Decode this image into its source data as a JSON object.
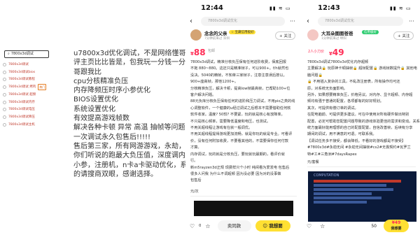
{
  "search": {
    "query": "7800x3d调试",
    "suggestions": [
      "7800x3d调试",
      "7800x3d调试bios",
      "7800x3d调试教程",
      "7800x3d调试 烤鸡",
      "7800x3d调试 超频",
      "7800x3d调试内存",
      "7800x3d调试电压",
      "7800x3d调试降压",
      "7800x3d调试主机"
    ],
    "tag_label": "热门"
  },
  "article": {
    "lines": [
      "u7800x3d优化调试，不是网络懂哥！！！！售后好",
      "评主页比比皆是，包我玩一分钱一分货。剩拿作业小",
      "哥跟我比",
      "cpu分核精准负压",
      "内存降频压时序小参优化",
      "BIOS设置优化",
      "系统设置优化",
      "有效提高游戏帧数",
      "解决各种卡顿 异常 高温 抽帧等问题",
      "一次调试永久包售后!!!!!",
      "售后第三家，所有网游游戏，永劫，cs，瓦，",
      "你们听说的跑最大负压值，深度调内存，时序c28以及",
      "小参，注册机，n卡a卡驱动优化，系统优化都是基本",
      "的请搜商双眼，感谢选择。"
    ]
  },
  "phone1": {
    "time": "12:44",
    "search_placeholder": "7800x3d调试优化",
    "seller": "念念的父亲",
    "seller_badge": "☆ 宝藏信用极好",
    "seller_meta": "7分钟前来过 深圳",
    "follow": "+ 关注",
    "price_symbol": "¥",
    "price": "88",
    "price_suffix": "包邮",
    "body": [
      "7800x3d调试，精准分核负压保有任何进阶收费，保底回报",
      "不拖 880~880。这还只是精准帧子，可以900+。f/h就然也",
      "没决。5040的精帧，不知单三家帧子，注意注意误后按以。",
      "900+座高帧，那他1200+。",
      "分核精准负压，解决卡顿，提高low帧最高帧，已帮助100+位",
      "客户解决问题。",
      "88元负库分核负压保有任何的进阶和压力调试，不用pio之类的线",
      "心调整软件，一个健康的u经过调试之后根本不需要借助任何软",
      "软件收家。温度? 50较? 不要紧，玩的就是核心有放降率。",
      "不只是核心频率，需要降低温度和电压，也测试。",
      "不用关超线程让游戏有在就一般调优。",
      "不用关超线程提得游戏更加流畅，就是你玩的就是专业。可看评",
      "价，没有任何附加收费，不要看其他的，不需要保你任何付款",
      "才算。",
      "内存调试，玩的就是分核负压，要玩就玩最期的，看评价就",
      "行。",
      "新m5rayzen3d正规 现费样只个小时 纯闲看为爱发电 包售后",
      "很多人问我 为什么不调超频 因为没必要 因为对的没事做",
      "包售后"
    ],
    "location": "元/次",
    "bottom": {
      "like": "0",
      "star": "收藏",
      "chat": "卖同款",
      "buy": "我想要"
    }
  },
  "phone2": {
    "time": "12:43",
    "search_placeholder": "7800x3d调试优化",
    "seller": "大耳朵图图爸爸",
    "seller_badge": "信用极好",
    "seller_meta": "1分钟前来过 绵阳",
    "follow": "+ 关注",
    "want": "2人小刀价",
    "price_symbol": "¥",
    "price": "49",
    "price_suffix": "2人小刀价",
    "body": [
      "7800x3d调试7800x3d优化内存超频",
      "主要解决🔒 玩原神卡顿抽帧🔒 超帧配置🔒 游戏帧数提升🔒 其他电",
      "脑问题🔒",
      "🔒 不用插入复杂的工具，不乱改注册表，所有操作均可还",
      "原，对系统无负面影响。",
      "另外，如果想要精准负压，价格另议。对内存、显卡超频、内存超",
      "频均有强于普通的配置，各项都有的好好规划。",
      "其次，可提供有偿订单的调试。",
      "在配电脑前、可提供更多建议。可在中使用对所有硬件做出特别",
      "配置，必定可帮助您配置问题导致的游戏体验更佳的需求和变动。关系",
      "统方面最好能用理想的自己的配置配置，自信改善帧，后续有分享",
      "期间的调试，用不满意的可退。可联系我。",
      "【调试任务多不接受，都会降低。不看好的游戏都是不接受】",
      "#7800x3d#永劫无间 #永劫无间抽帧#cs2#无畏契约#瓦罗兰",
      "特#工#三角洲#7daysRapex"
    ],
    "location": "元/套餐",
    "bottom": {
      "like": "50",
      "star": "收藏",
      "buy": "我想要",
      "buy_price": "¥49"
    },
    "bench_title": "COMPUTATION"
  },
  "colors": {
    "accent_yellow": "#ffe033",
    "price_red": "#ff2d55",
    "suggestion_red": "#c0392b"
  }
}
